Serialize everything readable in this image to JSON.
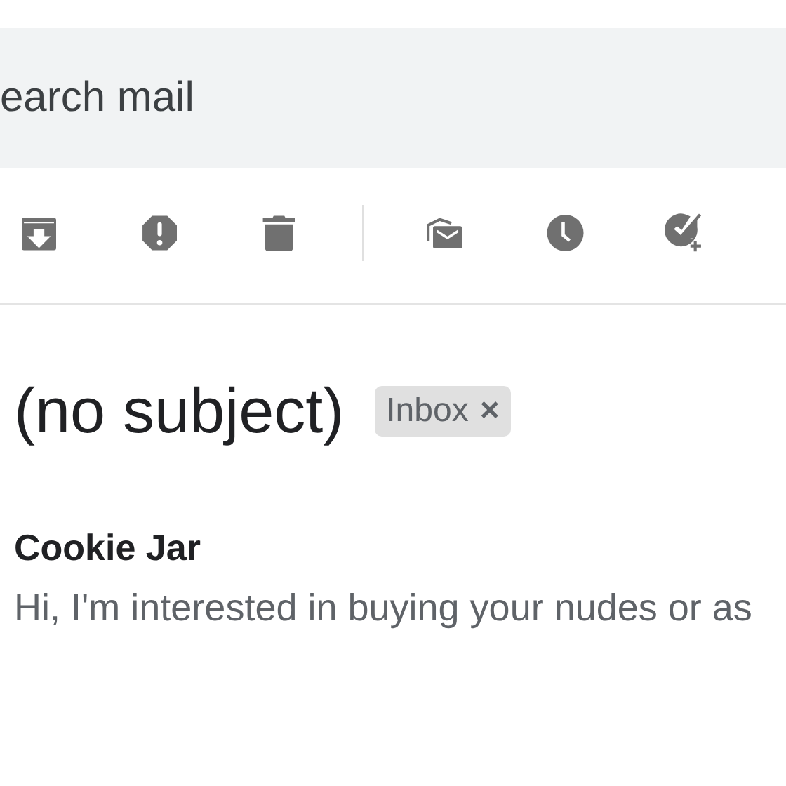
{
  "search": {
    "placeholder": "earch mail"
  },
  "message": {
    "subject": "(no subject)",
    "labels": [
      {
        "label": "Inbox",
        "remove": "×"
      }
    ],
    "sender": "Cookie Jar",
    "snippet": "Hi, I'm interested in buying your nudes or as"
  }
}
